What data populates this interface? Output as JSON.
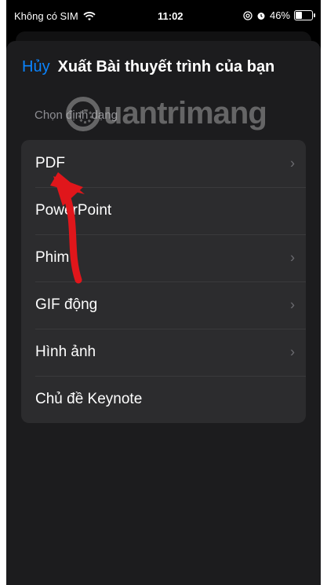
{
  "status_bar": {
    "carrier": "Không có SIM",
    "time": "11:02",
    "battery_percent": "46%",
    "battery_level": 0.46,
    "icons": [
      "wifi-icon",
      "at-icon",
      "alarm-icon",
      "battery-icon"
    ]
  },
  "header": {
    "cancel_label": "Hủy",
    "title": "Xuất Bài thuyết trình của bạn"
  },
  "section": {
    "label": "Chọn định dạng"
  },
  "watermark": {
    "text": "uantrimang"
  },
  "formats": [
    {
      "label": "PDF",
      "chevron": true
    },
    {
      "label": "PowerPoint",
      "chevron": false
    },
    {
      "label": "Phim",
      "chevron": true
    },
    {
      "label": "GIF động",
      "chevron": true
    },
    {
      "label": "Hình ảnh",
      "chevron": true
    },
    {
      "label": "Chủ đề Keynote",
      "chevron": false
    }
  ],
  "colors": {
    "accent": "#0a84ff",
    "background": "#000000",
    "sheet": "#1c1c1e",
    "list": "#2c2c2e",
    "annotation_arrow": "#e0161b"
  }
}
